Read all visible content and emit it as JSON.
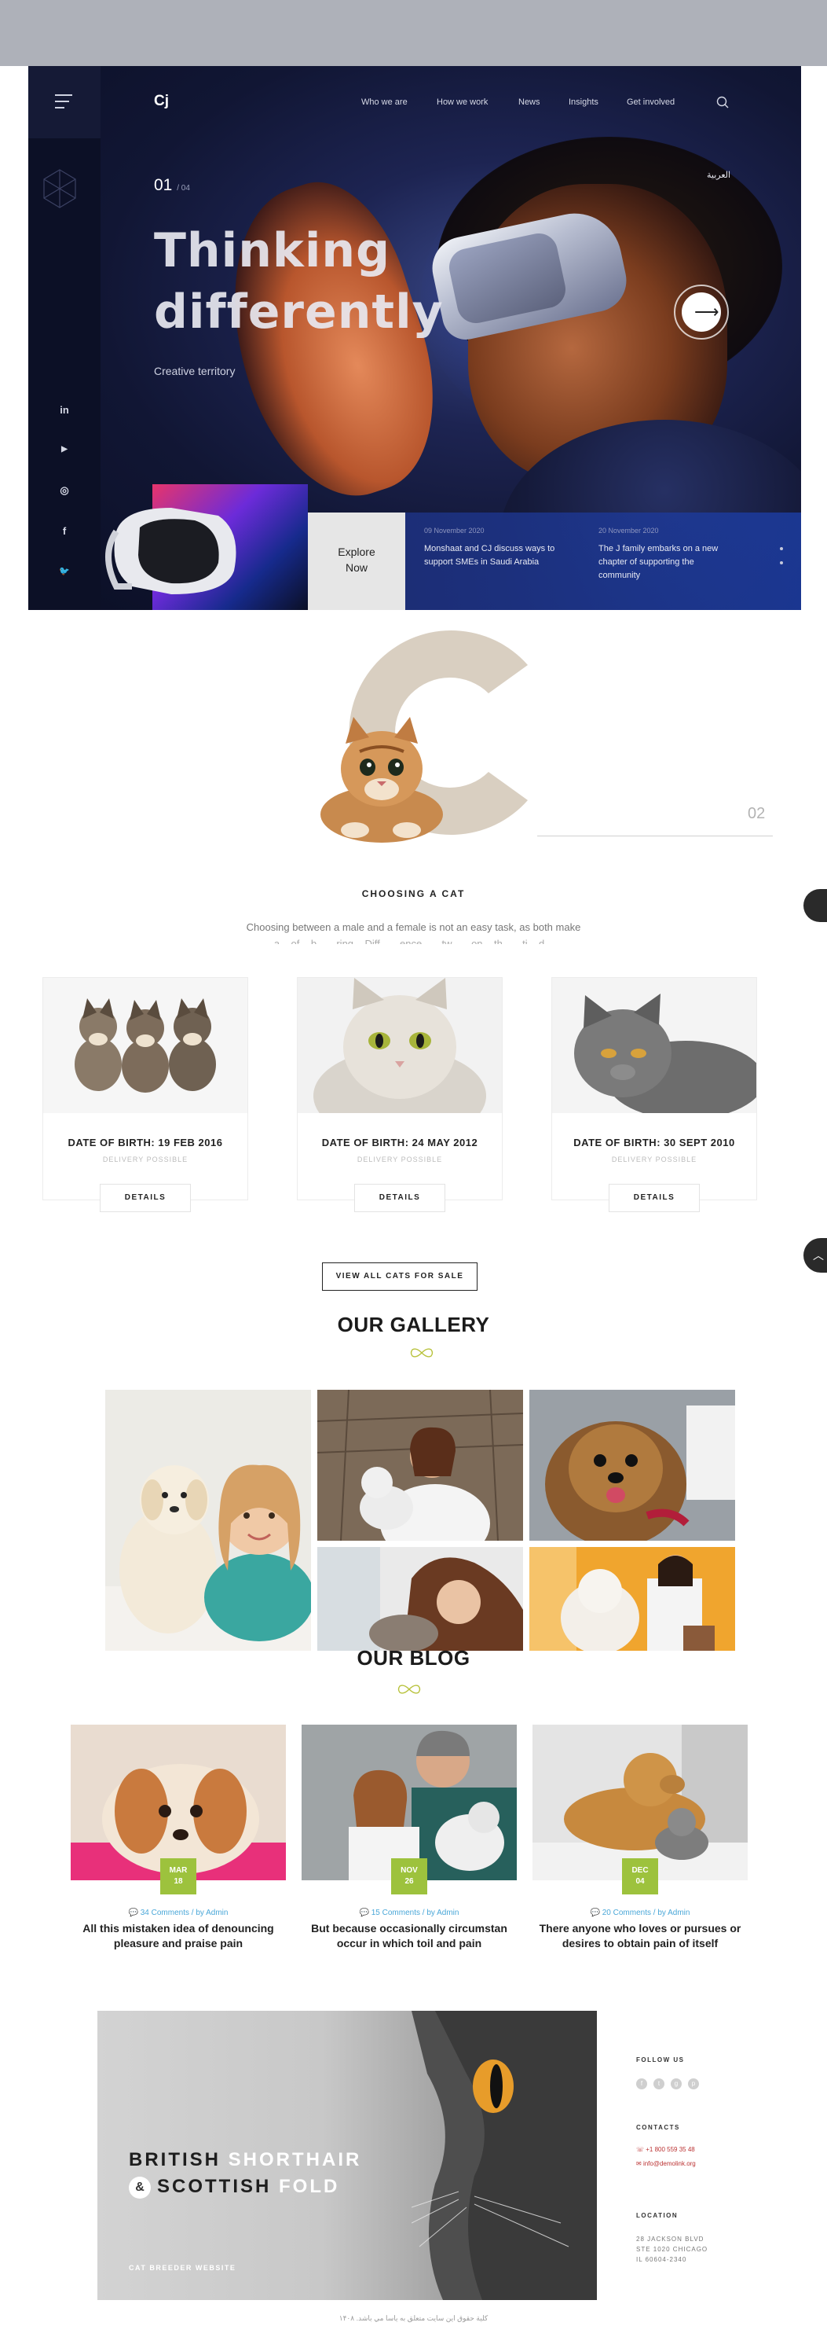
{
  "header": {
    "logo": "Cj",
    "nav": [
      "Who we are",
      "How we work",
      "News",
      "Insights",
      "Get involved"
    ],
    "language": "العربية"
  },
  "hero": {
    "slide_current": "01",
    "slide_total": "/ 04",
    "title_line1": "Thinking",
    "title_line2": "differently",
    "subtitle": "Creative territory",
    "explore_line1": "Explore",
    "explore_line2": "Now",
    "arrow_glyph": "⟶",
    "social": [
      {
        "icon": "linkedin-icon",
        "glyph": "in"
      },
      {
        "icon": "youtube-icon",
        "glyph": "▶"
      },
      {
        "icon": "instagram-icon",
        "glyph": "◎"
      },
      {
        "icon": "facebook-icon",
        "glyph": "f"
      },
      {
        "icon": "twitter-icon",
        "glyph": "🐦"
      }
    ],
    "news": [
      {
        "date": "09 November 2020",
        "text": "Monshaat and CJ discuss ways to support SMEs in Saudi Arabia"
      },
      {
        "date": "20 November 2020",
        "text": "The J family embarks on a new chapter of supporting the community"
      }
    ]
  },
  "intro": {
    "number": "02",
    "heading": "CHOOSING A CAT",
    "paragraph": "Choosing between a male and a female is not an easy task, as both make",
    "paragraph_cut": "a... of... b... ...ring... Diff... ...ence... ...tw... ...on... th... ...ti... d..."
  },
  "cats": [
    {
      "dob": "DATE OF BIRTH: 19 FEB 2016",
      "status": "DELIVERY POSSIBLE",
      "button": "DETAILS"
    },
    {
      "dob": "DATE OF BIRTH: 24 MAY 2012",
      "status": "DELIVERY POSSIBLE",
      "button": "DETAILS"
    },
    {
      "dob": "DATE OF BIRTH: 30 SEPT 2010",
      "status": "DELIVERY POSSIBLE",
      "button": "DETAILS"
    }
  ],
  "view_all": "VIEW ALL CATS FOR SALE",
  "gallery": {
    "title": "OUR GALLERY"
  },
  "blog": {
    "title": "OUR BLOG",
    "posts": [
      {
        "month": "MAR",
        "day": "18",
        "meta": "34 Comments / by Admin",
        "title": "All this mistaken idea of denouncing pleasure and praise pain"
      },
      {
        "month": "NOV",
        "day": "26",
        "meta": "15 Comments / by Admin",
        "title": "But because occasionally circumstan occur in which toil and pain"
      },
      {
        "month": "DEC",
        "day": "04",
        "meta": "20 Comments / by Admin",
        "title": "There anyone who loves or pursues or desires to obtain pain of itself"
      }
    ]
  },
  "footer": {
    "banner_line1_a": "BRITISH ",
    "banner_line1_b": "SHORTHAIR",
    "banner_amp": "&",
    "banner_line2_a": "SCOTTISH ",
    "banner_line2_b": "FOLD",
    "banner_small": "CAT BREEDER WEBSITE",
    "follow_label": "FOLLOW US",
    "contacts_label": "CONTACTS",
    "phone": "+1 800 559 35 48",
    "email": "info@demolink.org",
    "location_label": "LOCATION",
    "address1": "28 JACKSON BLVD",
    "address2": "STE 1020 CHICAGO",
    "address3": "IL 60604-2340",
    "copyright": "كلية حقوق اين سايت متعلق به ياسا مي باشد. ۱۴۰۸"
  },
  "colors": {
    "hero_bg": "#111634",
    "accent_green": "#9dc23d",
    "meta_blue": "#4aa7d8",
    "c_letter": "#d9cfc1"
  }
}
